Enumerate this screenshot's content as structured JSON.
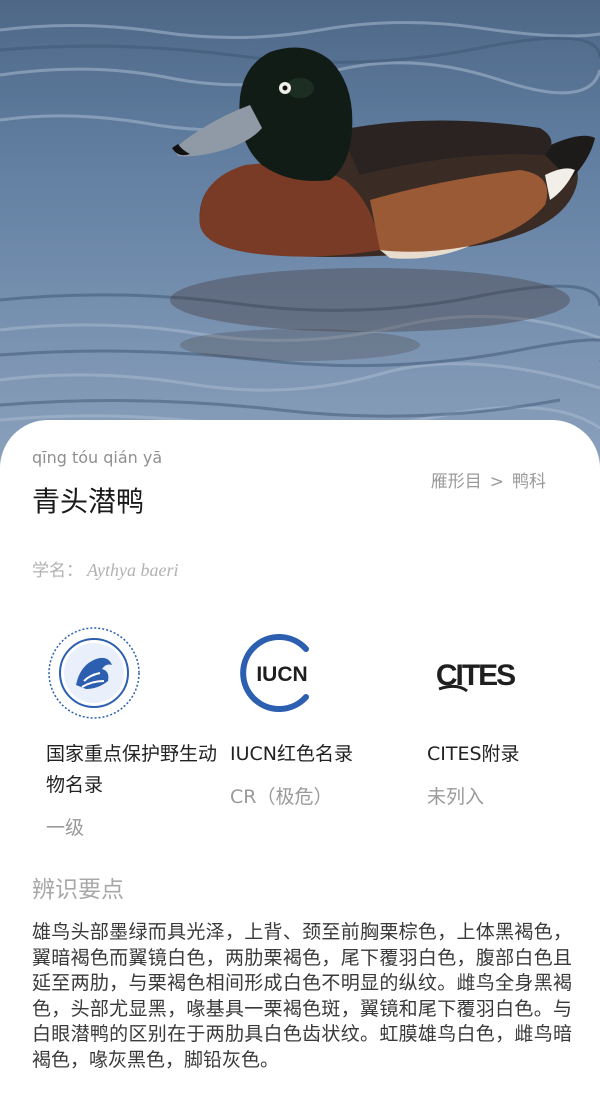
{
  "species": {
    "pinyin": "qīng tóu qián yā",
    "name": "青头潜鸭",
    "order": "雁形目",
    "separator": ">",
    "family": "鸭科",
    "scientific_label": "学名：",
    "scientific_name": "Aythya baeri"
  },
  "status": [
    {
      "logo": "china-wildlife-protection-logo",
      "title": "国家重点保护野生动物名录",
      "value": "一级"
    },
    {
      "logo": "iucn-logo",
      "logo_text": "IUCN",
      "title": "IUCN红色名录",
      "value": "CR（极危）"
    },
    {
      "logo": "cites-logo",
      "logo_text": "CITES",
      "title": "CITES附录",
      "value": "未列入"
    }
  ],
  "features": {
    "heading": "辨识要点",
    "text": "雄鸟头部墨绿而具光泽，上背、颈至前胸栗棕色，上体黑褐色，翼暗褐色而翼镜白色，两肋栗褐色，尾下覆羽白色，腹部白色且延至两肋，与栗褐色相间形成白色不明显的纵纹。雌鸟全身黑褐色，头部尤显黑，喙基具一栗褐色斑，翼镜和尾下覆羽白色。与白眼潜鸭的区别在于两肋具白色齿状纹。虹膜雄鸟白色，雌鸟暗褐色，喙灰黑色，脚铅灰色。"
  },
  "colors": {
    "accent_blue": "#2d5fb0",
    "text_muted": "#9a9a9a"
  }
}
